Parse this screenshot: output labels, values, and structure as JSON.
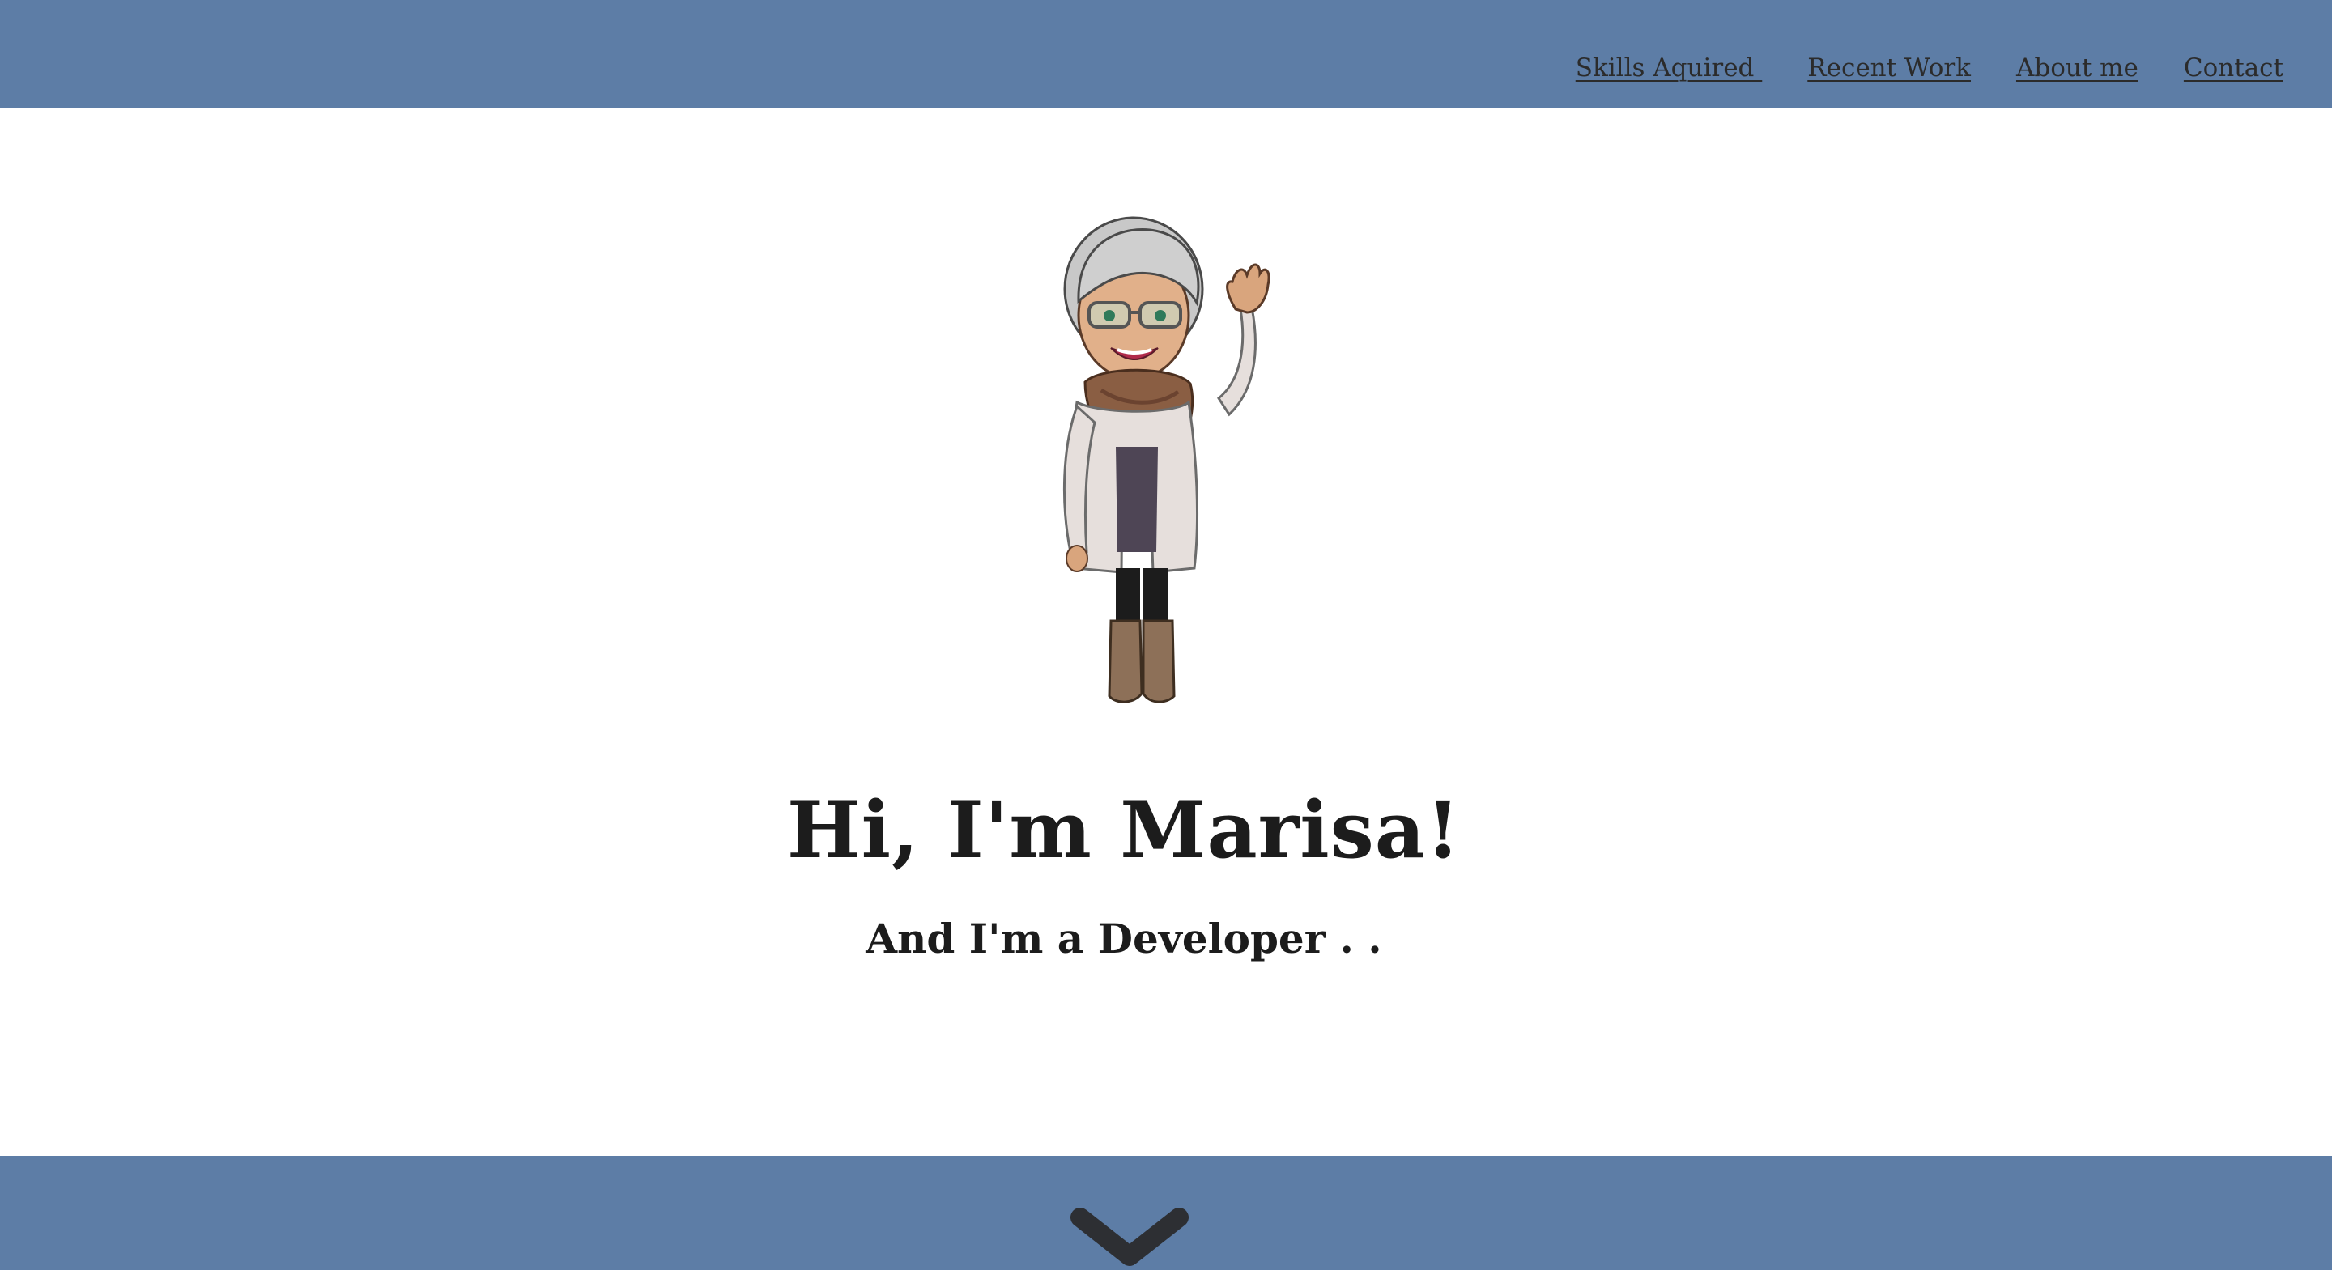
{
  "nav": {
    "items": [
      {
        "label": "Skills Aquired "
      },
      {
        "label": "Recent Work"
      },
      {
        "label": "About me"
      },
      {
        "label": "Contact"
      }
    ]
  },
  "hero": {
    "avatar_icon": "waving-woman-avatar",
    "title": "Hi, I'm Marisa!",
    "subtitle": "And I'm a Developer . ."
  },
  "footer": {
    "scroll_icon": "chevron-down-icon"
  },
  "colors": {
    "accent": "#5d7da6",
    "text": "#1c1c1c",
    "background": "#ffffff"
  }
}
